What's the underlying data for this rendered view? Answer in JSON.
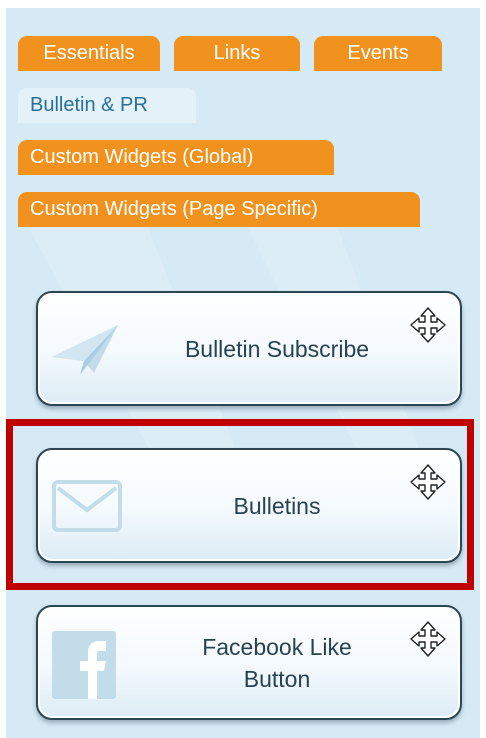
{
  "tabs": {
    "essentials": "Essentials",
    "links": "Links",
    "events": "Events",
    "bulletin_pr": "Bulletin & PR",
    "custom_global": "Custom Widgets (Global)",
    "custom_page": "Custom Widgets (Page Specific)"
  },
  "widgets": [
    {
      "label": "Bulletin Subscribe",
      "icon": "paper-plane-icon",
      "selected": false
    },
    {
      "label": "Bulletins",
      "icon": "envelope-icon",
      "selected": true
    },
    {
      "label": "Facebook Like\nButton",
      "icon": "facebook-icon",
      "selected": false
    }
  ],
  "colors": {
    "tab_bg": "#f1921f",
    "tab_active_bg": "#e3f1f9",
    "panel_bg": "#d6eaf5",
    "selection_border": "#c00000"
  }
}
